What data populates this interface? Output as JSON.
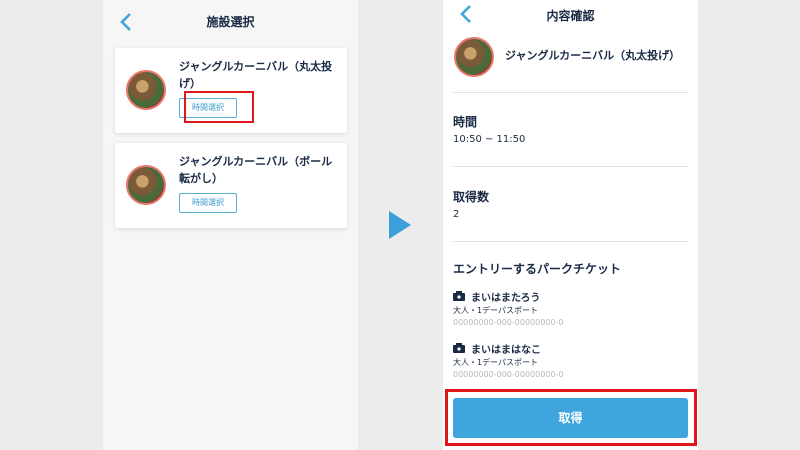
{
  "left": {
    "title": "施設選択",
    "cards": [
      {
        "title": "ジャングルカーニバル（丸太投げ）",
        "button": "時間選択"
      },
      {
        "title": "ジャングルカーニバル（ボール転がし）",
        "button": "時間選択"
      }
    ]
  },
  "right": {
    "title": "内容確認",
    "attraction": "ジャングルカーニバル（丸太投げ）",
    "time_label": "時間",
    "time_value": "10:50 ~ 11:50",
    "count_label": "取得数",
    "count_value": "2",
    "tickets_label": "エントリーするパークチケット",
    "tickets": [
      {
        "name": "まいはまたろう",
        "type": "大人・1デーパスポート",
        "id": "00000000-000-00000000-0"
      },
      {
        "name": "まいはまはなこ",
        "type": "大人・1デーパスポート",
        "id": "00000000-000-00000000-0"
      }
    ],
    "submit": "取得"
  },
  "colors": {
    "accent": "#3ea6dc",
    "highlight": "#e0161a",
    "text": "#1a2a44"
  },
  "icons": [
    "back-chevron-icon",
    "ticket-icon",
    "next-arrow-icon"
  ]
}
